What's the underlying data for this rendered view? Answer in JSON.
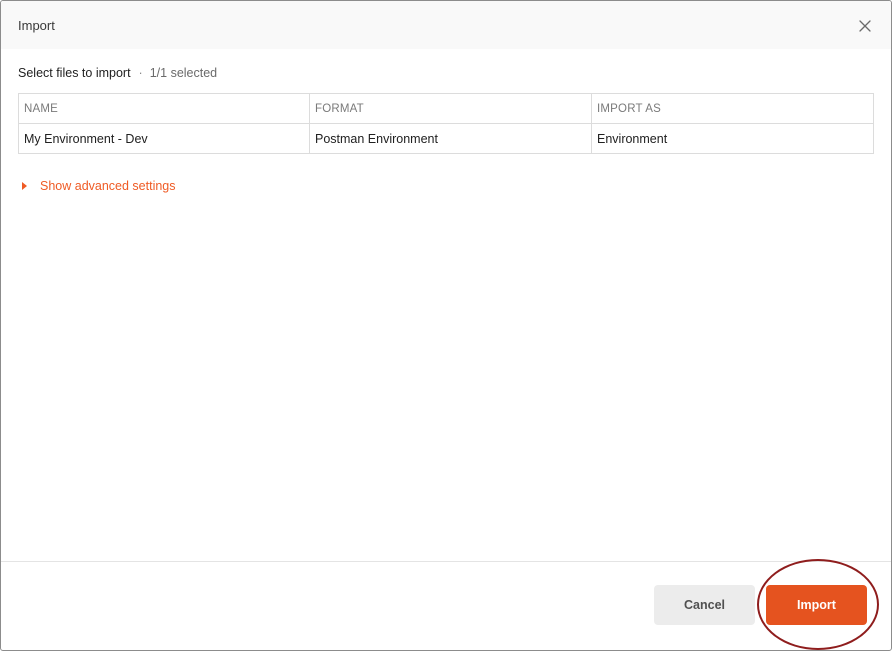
{
  "dialog": {
    "title": "Import",
    "close_icon": "close-icon"
  },
  "selection": {
    "label": "Select files to import",
    "separator": "·",
    "count": "1/1 selected"
  },
  "table": {
    "columns": [
      "NAME",
      "FORMAT",
      "IMPORT AS"
    ],
    "rows": [
      [
        "My Environment - Dev",
        "Postman Environment",
        "Environment"
      ]
    ]
  },
  "advanced": {
    "label": "Show advanced settings",
    "icon": "caret-right-icon"
  },
  "footer": {
    "cancel_label": "Cancel",
    "import_label": "Import"
  },
  "colors": {
    "accent": "#ef5b25",
    "import_button": "#e5531f",
    "cancel_button": "#ececec",
    "highlight_ring": "#8f1d1d"
  }
}
